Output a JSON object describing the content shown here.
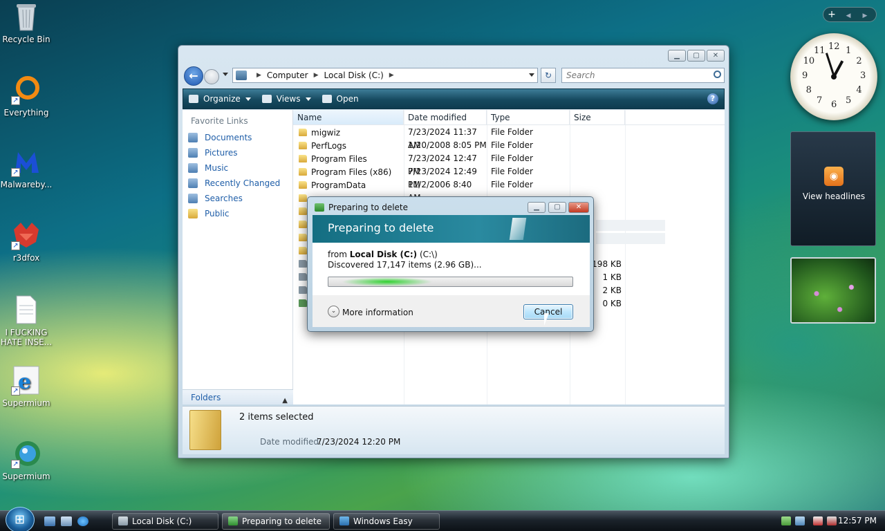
{
  "desktop": {
    "icons": [
      {
        "label": "Recycle Bin",
        "icon": "recycle-bin-icon"
      },
      {
        "label": "Everything",
        "icon": "everything-icon"
      },
      {
        "label": "Malwareby...",
        "icon": "malwarebytes-icon"
      },
      {
        "label": "r3dfox",
        "icon": "r3dfox-icon"
      },
      {
        "label": "I FUCKING HATE INSE...",
        "icon": "text-document-icon"
      },
      {
        "label": "Supermium",
        "icon": "internet-explorer-icon"
      },
      {
        "label": "Supermium",
        "icon": "supermium-globe-icon"
      }
    ]
  },
  "explorer": {
    "breadcrumb": [
      "Computer",
      "Local Disk (C:)"
    ],
    "search_placeholder": "Search",
    "toolbar": {
      "organize": "Organize",
      "views": "Views",
      "open": "Open",
      "help": "?"
    },
    "favorite_links_title": "Favorite Links",
    "favorite_links": [
      "Documents",
      "Pictures",
      "Music",
      "Recently Changed",
      "Searches",
      "Public"
    ],
    "folders_label": "Folders",
    "columns": [
      "Name",
      "Date modified",
      "Type",
      "Size"
    ],
    "files": [
      {
        "name": "migwiz",
        "date": "7/23/2024 11:37 AM",
        "type": "File Folder"
      },
      {
        "name": "PerfLogs",
        "date": "1/20/2008 8:05 PM",
        "type": "File Folder"
      },
      {
        "name": "Program Files",
        "date": "7/23/2024 12:47 PM",
        "type": "File Folder"
      },
      {
        "name": "Program Files (x86)",
        "date": "7/23/2024 12:49 PM",
        "type": "File Folder"
      },
      {
        "name": "ProgramData",
        "date": "11/2/2006 8:40 AM",
        "type": "File Folder"
      }
    ],
    "partial_sizes": [
      "198 KB",
      "1 KB",
      "2 KB",
      "0 KB"
    ],
    "details": {
      "selected": "2 items selected",
      "date_label": "Date modified:",
      "date_value": "7/23/2024 12:20 PM"
    }
  },
  "dialog": {
    "title": "Preparing to delete",
    "heading": "Preparing to delete",
    "from_prefix": "from",
    "from_location": "Local Disk (C:)",
    "from_path": "(C:\\)",
    "discovered": "Discovered 17,147 items (2.96 GB)...",
    "progress_state": "indeterminate",
    "more_info": "More information",
    "cancel": "Cancel"
  },
  "gadgets": {
    "clock_numbers": [
      "12",
      "1",
      "2",
      "3",
      "4",
      "5",
      "6",
      "7",
      "8",
      "9",
      "10",
      "11"
    ],
    "clock_time": {
      "hours": 12,
      "minutes": 57
    },
    "headlines_label": "View headlines",
    "sidebar_buttons": [
      "+",
      "◀",
      "▶"
    ]
  },
  "taskbar": {
    "tasks": [
      "Local Disk (C:)",
      "Preparing to delete",
      "Windows Easy Trans..."
    ],
    "active_task": "Preparing to delete",
    "time": "12:57 PM"
  },
  "colors": {
    "toolbar": "#16495f",
    "link": "#1f5ea8",
    "progress": "#2fd12f"
  }
}
